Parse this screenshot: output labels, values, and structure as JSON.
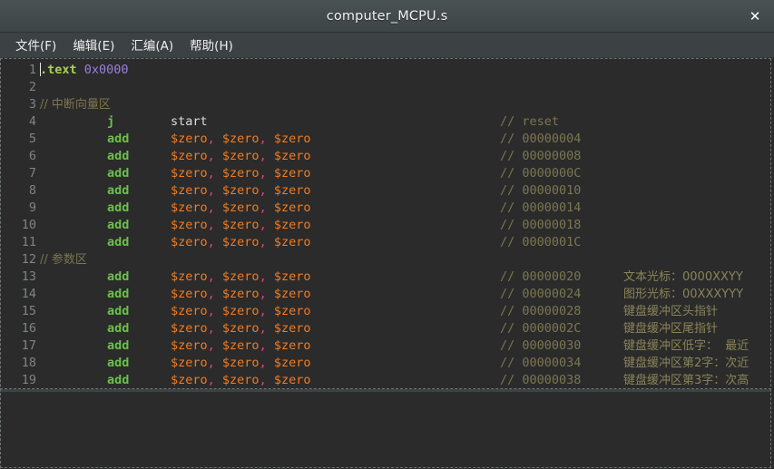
{
  "window": {
    "title": "computer_MCPU.s",
    "close_icon": "✕"
  },
  "menubar": {
    "items": [
      {
        "label": "文件(F)"
      },
      {
        "label": "编辑(E)"
      },
      {
        "label": "汇编(A)"
      },
      {
        "label": "帮助(H)"
      }
    ]
  },
  "editor": {
    "cursor_line": 1,
    "colors": {
      "background": "#2b2b2b",
      "directive": "#a6d44a",
      "number": "#9b7ede",
      "opcode": "#6bc04b",
      "register": "#f07c24",
      "comma": "#e0457b",
      "label": "#dcdcdc",
      "comment": "#7b7650",
      "gutter": "#7e8485",
      "titlebar": "#434a4c",
      "menubar": "#3c4143"
    },
    "lines": [
      {
        "n": "1",
        "directive": ".text",
        "number": "0x0000",
        "op": "",
        "args": "",
        "comment": "",
        "note": ""
      },
      {
        "n": "2",
        "directive": "",
        "number": "",
        "op": "",
        "args": "",
        "comment": "",
        "note": ""
      },
      {
        "n": "3",
        "directive": "",
        "number": "",
        "op": "",
        "args": "",
        "comment": "// 中断向量区",
        "note": "",
        "comment_inline": true
      },
      {
        "n": "4",
        "op": "j",
        "label": "start",
        "comment": "// reset",
        "note": ""
      },
      {
        "n": "5",
        "op": "add",
        "args": "$zero, $zero, $zero",
        "comment": "// 00000004",
        "note": ""
      },
      {
        "n": "6",
        "op": "add",
        "args": "$zero, $zero, $zero",
        "comment": "// 00000008",
        "note": ""
      },
      {
        "n": "7",
        "op": "add",
        "args": "$zero, $zero, $zero",
        "comment": "// 0000000C",
        "note": ""
      },
      {
        "n": "8",
        "op": "add",
        "args": "$zero, $zero, $zero",
        "comment": "// 00000010",
        "note": ""
      },
      {
        "n": "9",
        "op": "add",
        "args": "$zero, $zero, $zero",
        "comment": "// 00000014",
        "note": ""
      },
      {
        "n": "10",
        "op": "add",
        "args": "$zero, $zero, $zero",
        "comment": "// 00000018",
        "note": ""
      },
      {
        "n": "11",
        "op": "add",
        "args": "$zero, $zero, $zero",
        "comment": "// 0000001C",
        "note": ""
      },
      {
        "n": "12",
        "directive": "",
        "number": "",
        "op": "",
        "args": "",
        "comment": "// 参数区",
        "note": "",
        "comment_inline": true
      },
      {
        "n": "13",
        "op": "add",
        "args": "$zero, $zero, $zero",
        "comment": "// 00000020",
        "note": "文本光标：0000XXYY"
      },
      {
        "n": "14",
        "op": "add",
        "args": "$zero, $zero, $zero",
        "comment": "// 00000024",
        "note": "图形光标：00XXXYYY"
      },
      {
        "n": "15",
        "op": "add",
        "args": "$zero, $zero, $zero",
        "comment": "// 00000028",
        "note": "键盘缓冲区头指针"
      },
      {
        "n": "16",
        "op": "add",
        "args": "$zero, $zero, $zero",
        "comment": "// 0000002C",
        "note": "键盘缓冲区尾指针"
      },
      {
        "n": "17",
        "op": "add",
        "args": "$zero, $zero, $zero",
        "comment": "// 00000030",
        "note": "键盘缓冲区低字：  最近"
      },
      {
        "n": "18",
        "op": "add",
        "args": "$zero, $zero, $zero",
        "comment": "// 00000034",
        "note": "键盘缓冲区第2字：次近"
      },
      {
        "n": "19",
        "op": "add",
        "args": "$zero, $zero, $zero",
        "comment": "// 00000038",
        "note": "键盘缓冲区第3字：次高"
      }
    ]
  }
}
